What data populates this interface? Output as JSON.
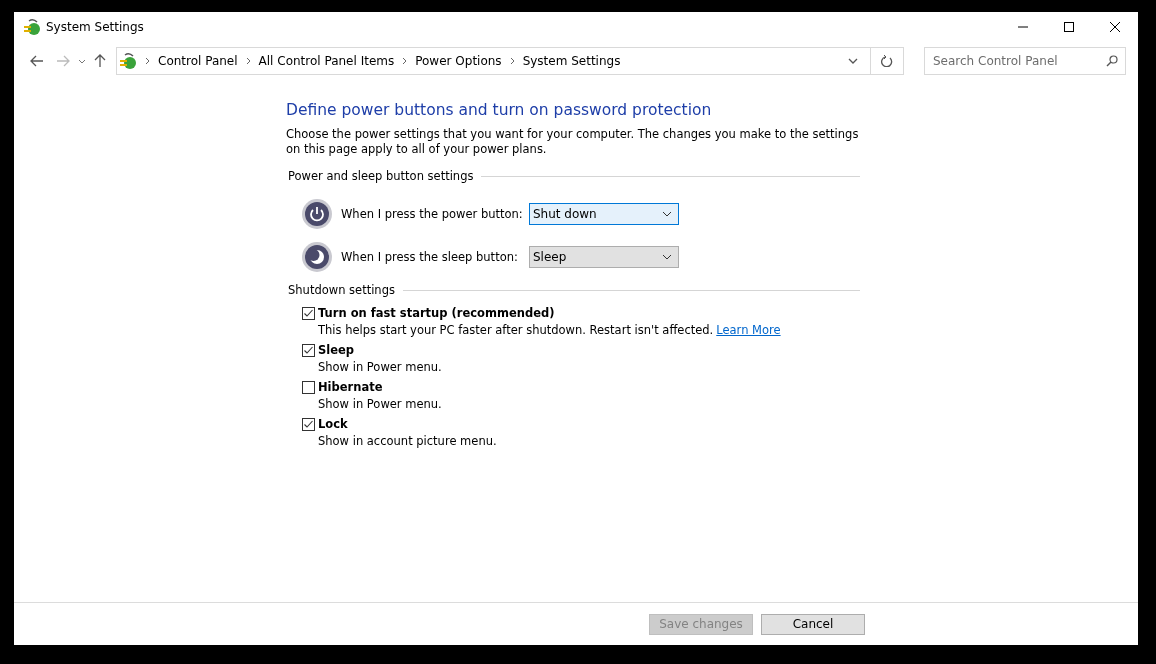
{
  "window": {
    "title": "System Settings"
  },
  "address_bar": {
    "breadcrumbs": [
      "Control Panel",
      "All Control Panel Items",
      "Power Options",
      "System Settings"
    ]
  },
  "search": {
    "placeholder": "Search Control Panel"
  },
  "heading": "Define power buttons and turn on password protection",
  "description": "Choose the power settings that you want for your computer. The changes you make to the settings on this page apply to all of your power plans.",
  "button_section": {
    "title": "Power and sleep button settings",
    "rows": [
      {
        "kind": "power",
        "label": "When I press the power button:",
        "value": "Shut down",
        "focused": true
      },
      {
        "kind": "sleep",
        "label": "When I press the sleep button:",
        "value": "Sleep",
        "focused": false
      }
    ]
  },
  "shutdown_section": {
    "title": "Shutdown settings",
    "options": [
      {
        "label": "Turn on fast startup (recommended)",
        "checked": true,
        "description": "This helps start your PC faster after shutdown. Restart isn't affected.",
        "link": "Learn More"
      },
      {
        "label": "Sleep",
        "checked": true,
        "description": "Show in Power menu."
      },
      {
        "label": "Hibernate",
        "checked": false,
        "description": "Show in Power menu."
      },
      {
        "label": "Lock",
        "checked": true,
        "description": "Show in account picture menu."
      }
    ]
  },
  "buttons": [
    {
      "label": "Save changes",
      "disabled": true
    },
    {
      "label": "Cancel",
      "disabled": false
    }
  ]
}
